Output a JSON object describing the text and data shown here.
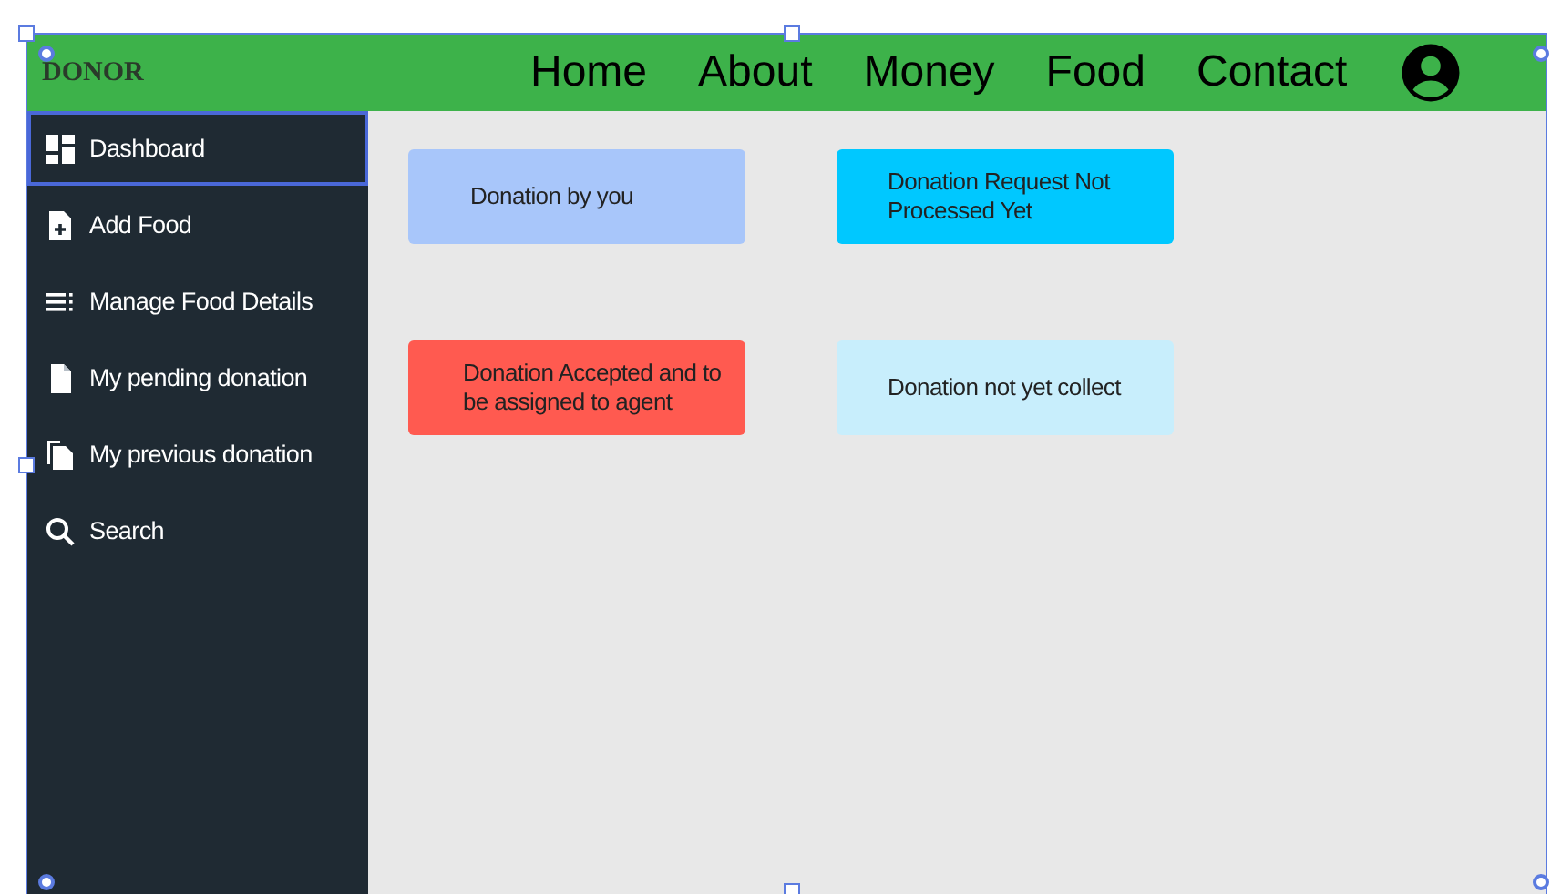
{
  "header": {
    "logo": "DONOR",
    "nav": [
      "Home",
      "About",
      "Money",
      "Food",
      "Contact"
    ]
  },
  "sidebar": {
    "items": [
      {
        "label": "Dashboard",
        "kind": "dashboard",
        "selected": true
      },
      {
        "label": "Add Food",
        "kind": "add",
        "selected": false
      },
      {
        "label": "Manage Food Details",
        "kind": "list",
        "selected": false
      },
      {
        "label": "My pending donation",
        "kind": "document",
        "selected": false
      },
      {
        "label": "My previous donation",
        "kind": "documents",
        "selected": false
      },
      {
        "label": "Search",
        "kind": "search",
        "selected": false
      }
    ]
  },
  "cards": [
    {
      "text": "Donation by you",
      "color": "#a8c6fa"
    },
    {
      "text": "Donation Request Not Processed Yet",
      "color": "#00c8ff"
    },
    {
      "text": "Donation Accepted and to be assigned to agent",
      "color": "#ff5a50"
    },
    {
      "text": "Donation  not yet collect",
      "color": "#c8eefc"
    }
  ]
}
